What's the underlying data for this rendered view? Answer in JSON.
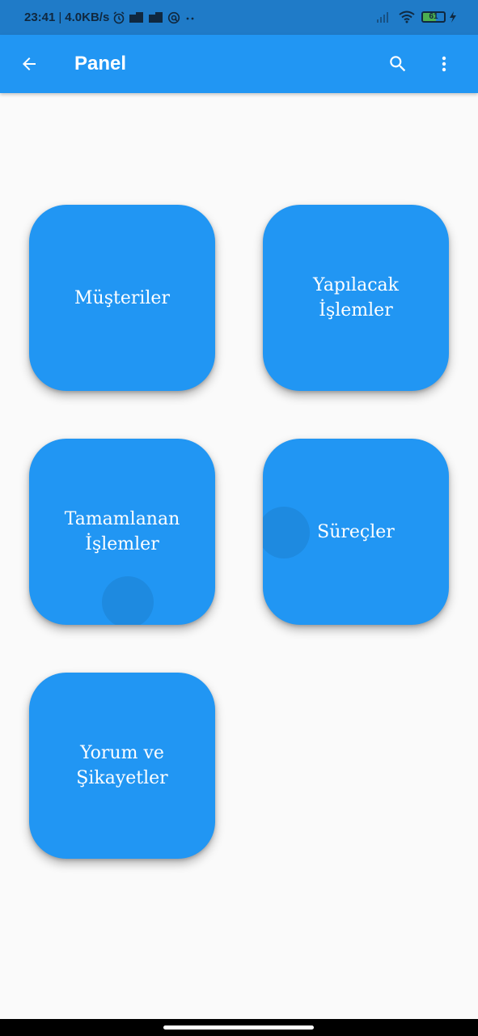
{
  "status_bar": {
    "time": "23:41",
    "network_speed": "4.0KB/s",
    "battery_level": "61",
    "battery_fraction": 0.61,
    "icons": [
      "alarm-icon",
      "notification-icon",
      "notification-icon",
      "vpn-icon",
      "more-dots-icon",
      "signal-icon",
      "wifi-icon",
      "battery-icon",
      "charging-icon"
    ]
  },
  "app_bar": {
    "title": "Panel",
    "back_icon": "arrow-back-icon",
    "search_icon": "search-icon",
    "more_icon": "more-vert-icon"
  },
  "tiles": [
    {
      "label": "Müşteriler"
    },
    {
      "label": "Yapılacak İşlemler"
    },
    {
      "label": "Tamamlanan İşlemler"
    },
    {
      "label": "Süreçler"
    },
    {
      "label": "Yorum ve Şikayetler"
    }
  ],
  "colors": {
    "status_bar": "#1f7bc8",
    "app_bar": "#2196f3",
    "tile": "#2196f3",
    "background": "#fafafa",
    "tile_text": "#ffffff"
  }
}
